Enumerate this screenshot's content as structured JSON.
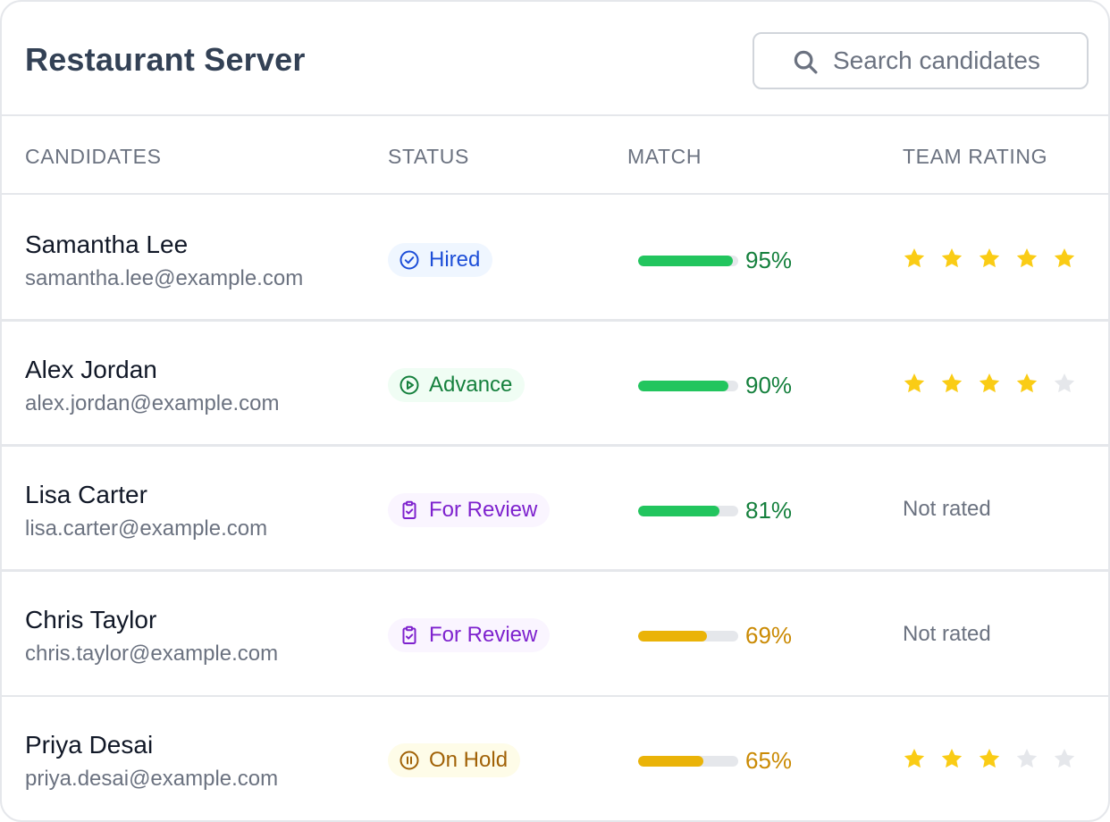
{
  "header": {
    "title": "Restaurant Server",
    "search_placeholder": "Search candidates",
    "search_value": ""
  },
  "columns": {
    "candidates": "CANDIDATES",
    "status": "STATUS",
    "match": "MATCH",
    "team_rating": "TEAM RATING"
  },
  "colors": {
    "match_high": "#22c55e",
    "match_high_text": "#15803d",
    "match_mid": "#eab308",
    "match_mid_text": "#ca8a04",
    "star_filled": "#facc15",
    "star_empty": "#e5e7eb"
  },
  "candidates": [
    {
      "name": "Samantha Lee",
      "email": "samantha.lee@example.com",
      "status": "Hired",
      "status_icon": "check-circle-icon",
      "match": "95%",
      "match_value": 95,
      "rating": 5,
      "rating_text": ""
    },
    {
      "name": "Alex Jordan",
      "email": "alex.jordan@example.com",
      "status": "Advance",
      "status_icon": "play-circle-icon",
      "match": "90%",
      "match_value": 90,
      "rating": 4,
      "rating_text": ""
    },
    {
      "name": "Lisa Carter",
      "email": "lisa.carter@example.com",
      "status": "For Review",
      "status_icon": "clipboard-check-icon",
      "match": "81%",
      "match_value": 81,
      "rating": 0,
      "rating_text": "Not rated"
    },
    {
      "name": "Chris Taylor",
      "email": "chris.taylor@example.com",
      "status": "For Review",
      "status_icon": "clipboard-check-icon",
      "match": "69%",
      "match_value": 69,
      "rating": 0,
      "rating_text": "Not rated"
    },
    {
      "name": "Priya Desai",
      "email": "priya.desai@example.com",
      "status": "On Hold",
      "status_icon": "pause-circle-icon",
      "match": "65%",
      "match_value": 65,
      "rating": 3,
      "rating_text": ""
    }
  ]
}
